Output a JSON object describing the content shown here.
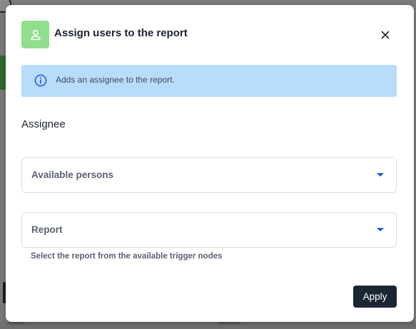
{
  "modal": {
    "title": "Assign users to the report",
    "header_icon": "person-icon",
    "close_icon": "close-icon",
    "colors": {
      "header_icon_bg": "#8fdf8c",
      "banner_bg": "#b8dcfb",
      "accent": "#1c57e6",
      "primary_button": "#1b2634"
    }
  },
  "info_banner": {
    "icon": "info-icon",
    "text": "Adds an assignee to the report."
  },
  "assignee": {
    "section_label": "Assignee",
    "persons_select": {
      "label": "Available persons",
      "caret_icon": "caret-down-icon"
    },
    "report_select": {
      "label": "Report",
      "caret_icon": "caret-down-icon",
      "helper_text": "Select the report from the available trigger nodes"
    }
  },
  "footer": {
    "apply_label": "Apply"
  }
}
